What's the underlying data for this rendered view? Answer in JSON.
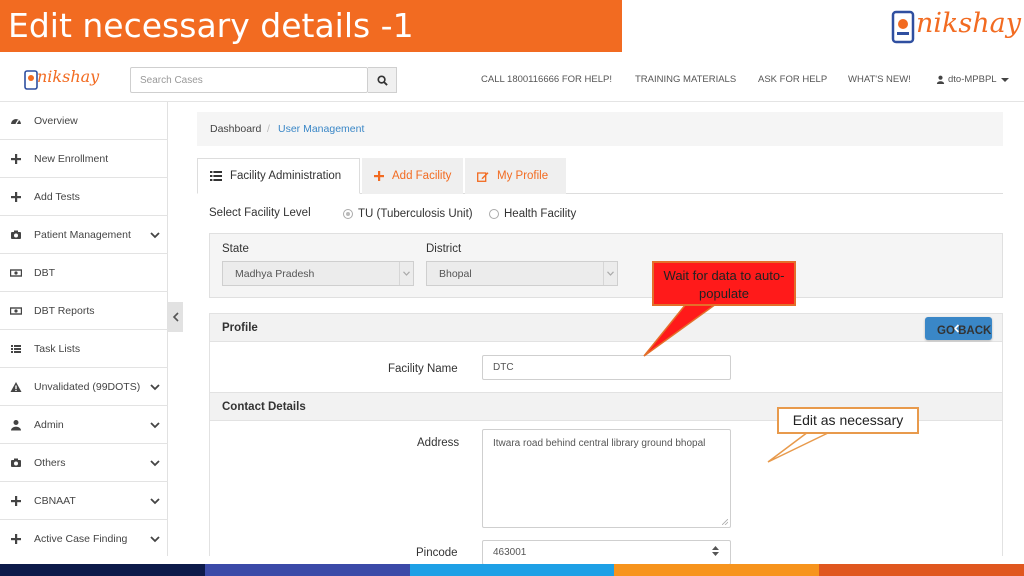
{
  "slide": {
    "title": "Edit necessary details -1",
    "corner_logo_text": "nikshay"
  },
  "navbar": {
    "logo_text": "nikshay",
    "search_placeholder": "Search Cases",
    "links": [
      "CALL 1800116666 FOR HELP!",
      "TRAINING MATERIALS",
      "ASK FOR HELP",
      "WHAT'S NEW!"
    ],
    "user": "dto-MPBPL"
  },
  "sidebar": {
    "items": [
      {
        "label": "Overview",
        "icon": "dashboard-icon",
        "expandable": false
      },
      {
        "label": "New Enrollment",
        "icon": "plus-icon",
        "expandable": false
      },
      {
        "label": "Add Tests",
        "icon": "plus-icon",
        "expandable": false
      },
      {
        "label": "Patient Management",
        "icon": "camera-icon",
        "expandable": true
      },
      {
        "label": "DBT",
        "icon": "money-icon",
        "expandable": false
      },
      {
        "label": "DBT Reports",
        "icon": "money-icon",
        "expandable": false
      },
      {
        "label": "Task Lists",
        "icon": "list-icon",
        "expandable": false
      },
      {
        "label": "Unvalidated (99DOTS)",
        "icon": "warning-icon",
        "expandable": true
      },
      {
        "label": "Admin",
        "icon": "user-icon",
        "expandable": true
      },
      {
        "label": "Others",
        "icon": "camera-icon",
        "expandable": true
      },
      {
        "label": "CBNAAT",
        "icon": "plus-icon",
        "expandable": true
      },
      {
        "label": "Active Case Finding",
        "icon": "plus-icon",
        "expandable": true
      }
    ]
  },
  "breadcrumb": {
    "home": "Dashboard",
    "separator": "/",
    "current": "User Management"
  },
  "tabs": [
    {
      "label": "Facility Administration",
      "active": true
    },
    {
      "label": "Add Facility",
      "active": false
    },
    {
      "label": "My Profile",
      "active": false
    }
  ],
  "facility_level": {
    "label": "Select Facility Level",
    "options": [
      {
        "label": "TU (Tuberculosis Unit)",
        "selected": true
      },
      {
        "label": "Health Facility",
        "selected": false
      }
    ]
  },
  "location": {
    "state_label": "State",
    "state_value": "Madhya Pradesh",
    "district_label": "District",
    "district_value": "Bhopal"
  },
  "profile": {
    "heading": "Profile",
    "go_back": "GO BACK",
    "facility_name_label": "Facility Name",
    "facility_name_value": "DTC"
  },
  "contact": {
    "heading": "Contact Details",
    "address_label": "Address",
    "address_value": "Itwara road behind central library ground bhopal",
    "pincode_label": "Pincode",
    "pincode_value": "463001"
  },
  "callouts": {
    "autopopulate": "Wait for data to auto-populate",
    "edit": "Edit as necessary"
  },
  "colors": {
    "accent": "#f26b21",
    "link_blue": "#3a87c7",
    "callout_red": "#ff1a1a",
    "footer": [
      "#0d1a4a",
      "#3b4aa8",
      "#1ea0e6",
      "#f7941d",
      "#e0571f"
    ]
  }
}
